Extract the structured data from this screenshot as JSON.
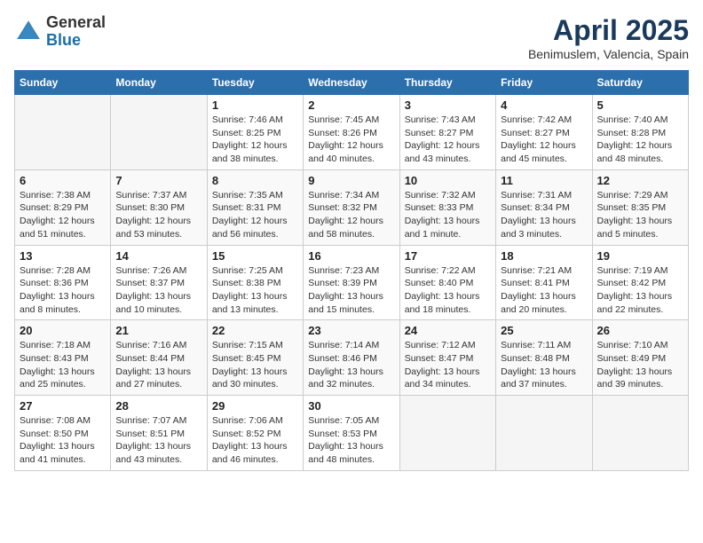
{
  "logo": {
    "general": "General",
    "blue": "Blue"
  },
  "title": "April 2025",
  "location": "Benimuslem, Valencia, Spain",
  "days_of_week": [
    "Sunday",
    "Monday",
    "Tuesday",
    "Wednesday",
    "Thursday",
    "Friday",
    "Saturday"
  ],
  "weeks": [
    [
      {
        "day": "",
        "info": ""
      },
      {
        "day": "",
        "info": ""
      },
      {
        "day": "1",
        "info": "Sunrise: 7:46 AM\nSunset: 8:25 PM\nDaylight: 12 hours and 38 minutes."
      },
      {
        "day": "2",
        "info": "Sunrise: 7:45 AM\nSunset: 8:26 PM\nDaylight: 12 hours and 40 minutes."
      },
      {
        "day": "3",
        "info": "Sunrise: 7:43 AM\nSunset: 8:27 PM\nDaylight: 12 hours and 43 minutes."
      },
      {
        "day": "4",
        "info": "Sunrise: 7:42 AM\nSunset: 8:27 PM\nDaylight: 12 hours and 45 minutes."
      },
      {
        "day": "5",
        "info": "Sunrise: 7:40 AM\nSunset: 8:28 PM\nDaylight: 12 hours and 48 minutes."
      }
    ],
    [
      {
        "day": "6",
        "info": "Sunrise: 7:38 AM\nSunset: 8:29 PM\nDaylight: 12 hours and 51 minutes."
      },
      {
        "day": "7",
        "info": "Sunrise: 7:37 AM\nSunset: 8:30 PM\nDaylight: 12 hours and 53 minutes."
      },
      {
        "day": "8",
        "info": "Sunrise: 7:35 AM\nSunset: 8:31 PM\nDaylight: 12 hours and 56 minutes."
      },
      {
        "day": "9",
        "info": "Sunrise: 7:34 AM\nSunset: 8:32 PM\nDaylight: 12 hours and 58 minutes."
      },
      {
        "day": "10",
        "info": "Sunrise: 7:32 AM\nSunset: 8:33 PM\nDaylight: 13 hours and 1 minute."
      },
      {
        "day": "11",
        "info": "Sunrise: 7:31 AM\nSunset: 8:34 PM\nDaylight: 13 hours and 3 minutes."
      },
      {
        "day": "12",
        "info": "Sunrise: 7:29 AM\nSunset: 8:35 PM\nDaylight: 13 hours and 5 minutes."
      }
    ],
    [
      {
        "day": "13",
        "info": "Sunrise: 7:28 AM\nSunset: 8:36 PM\nDaylight: 13 hours and 8 minutes."
      },
      {
        "day": "14",
        "info": "Sunrise: 7:26 AM\nSunset: 8:37 PM\nDaylight: 13 hours and 10 minutes."
      },
      {
        "day": "15",
        "info": "Sunrise: 7:25 AM\nSunset: 8:38 PM\nDaylight: 13 hours and 13 minutes."
      },
      {
        "day": "16",
        "info": "Sunrise: 7:23 AM\nSunset: 8:39 PM\nDaylight: 13 hours and 15 minutes."
      },
      {
        "day": "17",
        "info": "Sunrise: 7:22 AM\nSunset: 8:40 PM\nDaylight: 13 hours and 18 minutes."
      },
      {
        "day": "18",
        "info": "Sunrise: 7:21 AM\nSunset: 8:41 PM\nDaylight: 13 hours and 20 minutes."
      },
      {
        "day": "19",
        "info": "Sunrise: 7:19 AM\nSunset: 8:42 PM\nDaylight: 13 hours and 22 minutes."
      }
    ],
    [
      {
        "day": "20",
        "info": "Sunrise: 7:18 AM\nSunset: 8:43 PM\nDaylight: 13 hours and 25 minutes."
      },
      {
        "day": "21",
        "info": "Sunrise: 7:16 AM\nSunset: 8:44 PM\nDaylight: 13 hours and 27 minutes."
      },
      {
        "day": "22",
        "info": "Sunrise: 7:15 AM\nSunset: 8:45 PM\nDaylight: 13 hours and 30 minutes."
      },
      {
        "day": "23",
        "info": "Sunrise: 7:14 AM\nSunset: 8:46 PM\nDaylight: 13 hours and 32 minutes."
      },
      {
        "day": "24",
        "info": "Sunrise: 7:12 AM\nSunset: 8:47 PM\nDaylight: 13 hours and 34 minutes."
      },
      {
        "day": "25",
        "info": "Sunrise: 7:11 AM\nSunset: 8:48 PM\nDaylight: 13 hours and 37 minutes."
      },
      {
        "day": "26",
        "info": "Sunrise: 7:10 AM\nSunset: 8:49 PM\nDaylight: 13 hours and 39 minutes."
      }
    ],
    [
      {
        "day": "27",
        "info": "Sunrise: 7:08 AM\nSunset: 8:50 PM\nDaylight: 13 hours and 41 minutes."
      },
      {
        "day": "28",
        "info": "Sunrise: 7:07 AM\nSunset: 8:51 PM\nDaylight: 13 hours and 43 minutes."
      },
      {
        "day": "29",
        "info": "Sunrise: 7:06 AM\nSunset: 8:52 PM\nDaylight: 13 hours and 46 minutes."
      },
      {
        "day": "30",
        "info": "Sunrise: 7:05 AM\nSunset: 8:53 PM\nDaylight: 13 hours and 48 minutes."
      },
      {
        "day": "",
        "info": ""
      },
      {
        "day": "",
        "info": ""
      },
      {
        "day": "",
        "info": ""
      }
    ]
  ]
}
